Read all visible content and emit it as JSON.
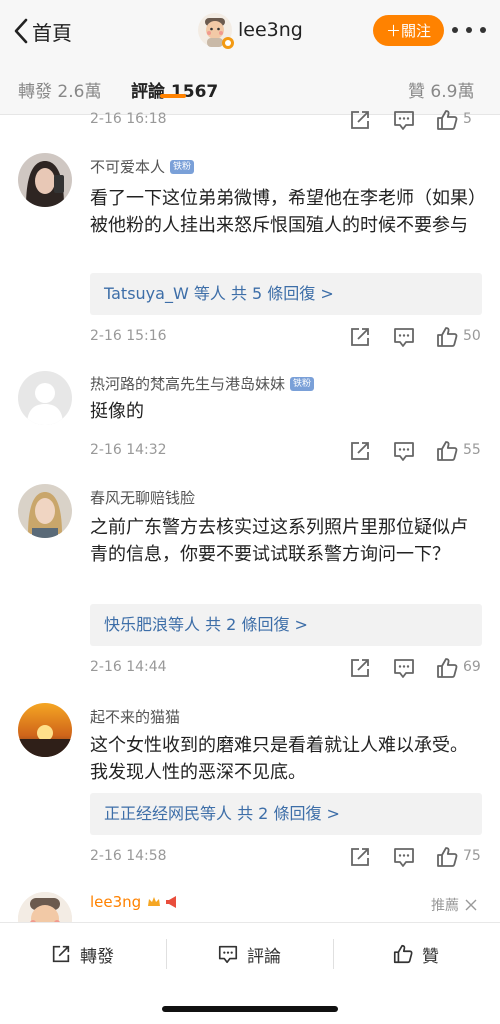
{
  "nav": {
    "back_label": "首頁",
    "username": "lee3ng",
    "follow_label": "＋關注"
  },
  "tabs": [
    {
      "label": "轉發 2.6萬"
    },
    {
      "label": "評論 1567"
    },
    {
      "label": "贊 6.9萬"
    }
  ],
  "partial_comment": {
    "time": "2-16 16:18",
    "likes": "5"
  },
  "comments": [
    {
      "name": "不可爱本人",
      "badge": "铁粉",
      "text": "看了一下这位弟弟微博，希望他在李老师（如果）被他粉的人挂出来怒斥恨国殖人的时候不要参与",
      "replies": "Tatsuya_W 等人 共 5 條回復 >",
      "time": "2-16 15:16",
      "likes": "50"
    },
    {
      "name": "热河路的梵高先生与港岛妹妹",
      "badge": "铁粉",
      "text": "挺像的",
      "time": "2-16 14:32",
      "likes": "55"
    },
    {
      "name": "春风无聊赔钱脸",
      "text": "之前广东警方去核实过这系列照片里那位疑似卢青的信息，你要不要试试联系警方询问一下？",
      "replies": "快乐肥浪等人 共 2 條回復 >",
      "time": "2-16 14:44",
      "likes": "69"
    },
    {
      "name": "起不来的猫猫",
      "text": "这个女性收到的磨难只是看着就让人难以承受。我发现人性的恶深不见底。",
      "replies": "正正经经网民等人 共 2 條回復 >",
      "time": "2-16 14:58",
      "likes": "75"
    },
    {
      "name": "lee3ng"
    }
  ],
  "recommended_label": "推薦",
  "bottom_bar": {
    "repost": "轉發",
    "comment": "評論",
    "like": "贊"
  },
  "colors": {
    "accent": "#ff8200",
    "link": "#3d6ea8",
    "muted": "#999999"
  }
}
